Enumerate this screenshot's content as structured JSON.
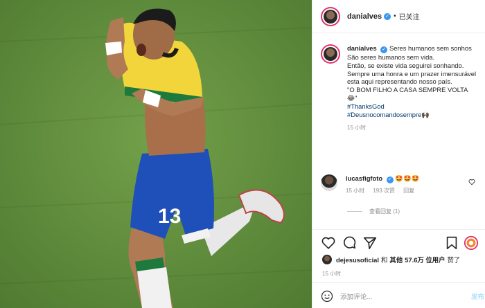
{
  "post": {
    "username": "danialves",
    "follow_status": "已关注",
    "caption_lines": [
      "Seres humanos sem sonhos São seres humanos sem vida.",
      "Então, se existe vida seguirei sonhando.",
      "Sempre uma honra e um prazer imensurável esta aqui representando nosso país.",
      "\"O BOM FILHO A CASA SEMPRE VOLTA 😂\""
    ],
    "hashtags": [
      "#ThanksGod",
      "#Deusnocomandosempre🙌🏿"
    ],
    "caption_time": "15 小时"
  },
  "comment": {
    "username": "lucasfigfoto",
    "text": "🤩🤩🤩",
    "time": "15 小时",
    "likes": "193 次赞",
    "reply": "回复",
    "view_replies": "查看回复 (1)"
  },
  "likes": {
    "user": "dejesusoficial",
    "text_and": "和",
    "text_others": "其他",
    "count": "57.6万 位用户",
    "text_liked": "赞了"
  },
  "post_time": "15 小时",
  "add_comment": {
    "placeholder": "添加评论...",
    "post_label": "发布"
  },
  "photo": {
    "jersey_number": "13",
    "colors": {
      "shirt": "#f2d53b",
      "shorts": "#1f4fb8",
      "pitch": "#5f8a3d"
    }
  }
}
